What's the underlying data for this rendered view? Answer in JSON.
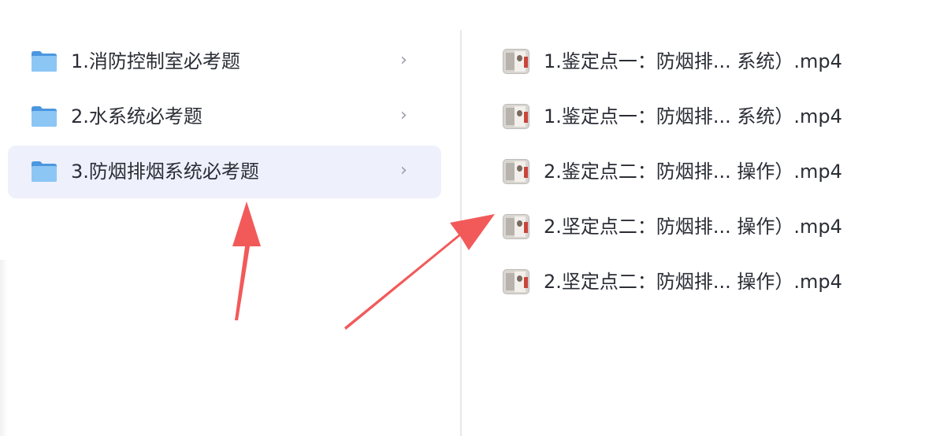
{
  "folders": [
    {
      "label": "1.消防控制室必考题",
      "icon": "folder-icon"
    },
    {
      "label": "2.水系统必考题",
      "icon": "folder-icon"
    },
    {
      "label": "3.防烟排烟系统必考题",
      "icon": "folder-icon",
      "selected": true
    }
  ],
  "chevron": "›",
  "files": [
    {
      "label": "1.鉴定点一：防烟排... 系统）.mp4",
      "icon": "video-thumbnail"
    },
    {
      "label": "1.鉴定点一：防烟排... 系统）.mp4",
      "icon": "video-thumbnail"
    },
    {
      "label": "2.鉴定点二：防烟排... 操作）.mp4",
      "icon": "video-thumbnail"
    },
    {
      "label": "2.坚定点二：防烟排... 操作）.mp4",
      "icon": "video-thumbnail"
    },
    {
      "label": "2.坚定点二：防烟排... 操作）.mp4",
      "icon": "video-thumbnail"
    }
  ],
  "colors": {
    "selected_row": "#eef0fb",
    "folder_blue": "#5aa8ec",
    "annotation_arrow": "#f25a5a",
    "text": "#2b2d36"
  }
}
